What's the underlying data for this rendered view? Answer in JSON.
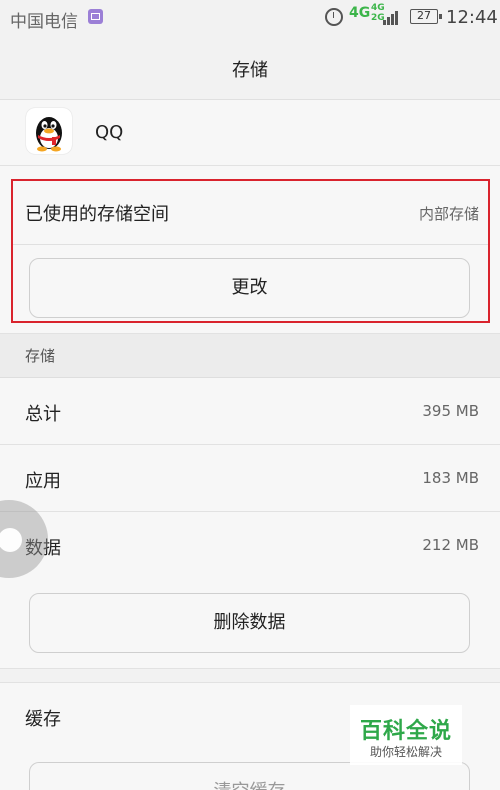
{
  "status_bar": {
    "carrier": "中国电信",
    "network": "4G",
    "network_stack_top": "4G",
    "network_stack_bottom": "2G",
    "battery": "27",
    "time": "12:44"
  },
  "title": "存储",
  "app": {
    "name": "QQ",
    "icon": "qq-penguin-icon"
  },
  "used_storage": {
    "label": "已使用的存储空间",
    "value": "内部存储",
    "change_button": "更改"
  },
  "storage_section": {
    "header": "存储",
    "rows": [
      {
        "label": "总计",
        "value": "395 MB"
      },
      {
        "label": "应用",
        "value": "183 MB"
      },
      {
        "label": "数据",
        "value": "212 MB"
      }
    ],
    "clear_data_button": "删除数据"
  },
  "cache_section": {
    "label": "缓存",
    "clear_cache_button": "清空缓存"
  },
  "watermark": {
    "main": "百科全说",
    "sub": "助你轻松解决"
  },
  "colors": {
    "highlight": "#d9232d",
    "watermark_green": "#2fa84a"
  }
}
